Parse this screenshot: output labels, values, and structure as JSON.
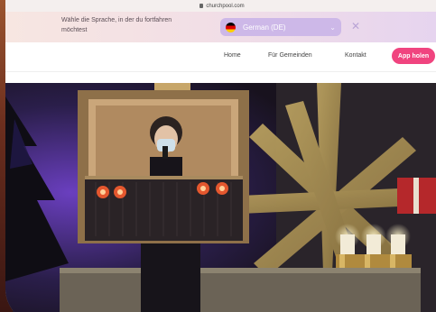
{
  "browser": {
    "url": "churchpool.com"
  },
  "language_banner": {
    "message": "Wähle die Sprache, in der du fortfahren möchtest",
    "selected_language": "German (DE)"
  },
  "nav": {
    "links": [
      "Home",
      "Für Gemeinden",
      "Kontakt"
    ],
    "cta_label": "App holen"
  },
  "colors": {
    "accent": "#f0447f",
    "select_bg": "#cdb8e8"
  },
  "icons": [
    "lock-icon",
    "german-flag-icon",
    "chevron-down-icon",
    "close-icon"
  ]
}
